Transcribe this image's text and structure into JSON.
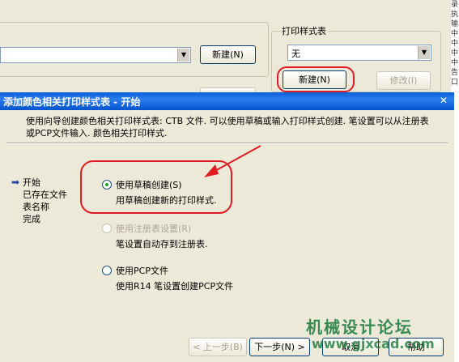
{
  "bg_dialog": {
    "new_button_left": "新建(N)",
    "plot_style_table_label": "打印样式表",
    "plot_style_value": "无",
    "new_button": "新建(N)",
    "modify_button": "修改(I)"
  },
  "edge_text": [
    "录",
    "执",
    "输",
    "中",
    "中",
    "中",
    "中",
    "告",
    "口"
  ],
  "wizard": {
    "title": "添加颜色相关打印样式表 - 开始",
    "description": "使用向导创建颜色相关打印样式表: CTB 文件. 可以使用草稿或输入打印样式创建. 笔设置可以从注册表或PCP文件输入. 颜色相关打印样式.",
    "steps": [
      "开始",
      "已存在文件",
      "表名称",
      "完成"
    ],
    "options": [
      {
        "label": "使用草稿创建(S)",
        "desc": "用草稿创建新的打印样式.",
        "checked": true,
        "disabled": false
      },
      {
        "label": "使用注册表设置(R)",
        "desc": "笔设置自动存到注册表.",
        "checked": false,
        "disabled": true
      },
      {
        "label": "使用PCP文件",
        "desc": "使用R14 笔设置创建PCP文件",
        "checked": false,
        "disabled": false
      }
    ],
    "buttons": {
      "back": "< 上一步(B)",
      "next": "下一步(N) >",
      "cancel": "取消",
      "help": "帮助"
    },
    "watermark": "机械设计论坛",
    "watermark_url": "www.gjxcad.com"
  }
}
